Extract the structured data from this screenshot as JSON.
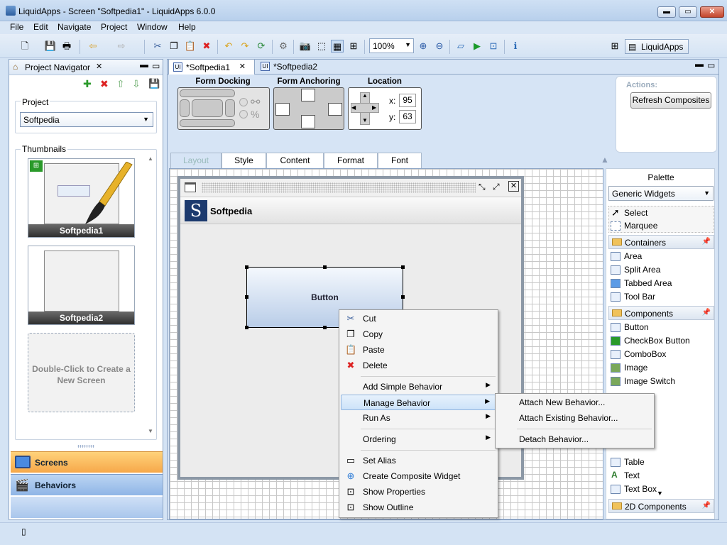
{
  "window": {
    "title": "LiquidApps - Screen \"Softpedia1\" - LiquidApps 6.0.0",
    "min_symbol": "▬",
    "max_symbol": "▭",
    "close_symbol": "✕"
  },
  "menubar": [
    {
      "label": "File"
    },
    {
      "label": "Edit"
    },
    {
      "label": "Navigate"
    },
    {
      "label": "Project"
    },
    {
      "label": "Window"
    },
    {
      "label": "Help"
    }
  ],
  "toolbar": {
    "zoom_value": "100%",
    "perspective_label": "LiquidApps"
  },
  "project_navigator": {
    "title": "Project Navigator",
    "project_label": "Project",
    "project_value": "Softpedia",
    "thumbnails_label": "Thumbnails",
    "thumbnails": [
      {
        "name": "Softpedia1"
      },
      {
        "name": "Softpedia2"
      }
    ],
    "new_screen_hint": "Double-Click to Create a New Screen",
    "screens_label": "Screens",
    "behaviors_label": "Behaviors"
  },
  "editor": {
    "tabs": [
      {
        "label": "*Softpedia1"
      },
      {
        "label": "*Softpedia2"
      }
    ],
    "form_docking_label": "Form Docking",
    "form_anchoring_label": "Form Anchoring",
    "location_label": "Location",
    "location_x_label": "x:",
    "location_x": "95",
    "location_y_label": "y:",
    "location_y": "63",
    "actions_label": "Actions:",
    "refresh_label": "Refresh Composites",
    "layout_tabs": [
      {
        "label": "Layout"
      },
      {
        "label": "Style"
      },
      {
        "label": "Content"
      },
      {
        "label": "Format"
      },
      {
        "label": "Font"
      }
    ]
  },
  "form": {
    "header_text": "Softpedia",
    "logo_letter": "S",
    "button_label": "Button"
  },
  "palette": {
    "title": "Palette",
    "set_value": "Generic Widgets",
    "tools": [
      {
        "label": "Select"
      },
      {
        "label": "Marquee"
      }
    ],
    "containers_label": "Containers",
    "containers": [
      {
        "label": "Area"
      },
      {
        "label": "Split Area"
      },
      {
        "label": "Tabbed Area"
      },
      {
        "label": "Tool Bar"
      }
    ],
    "components_label": "Components",
    "components": [
      {
        "label": "Button"
      },
      {
        "label": "CheckBox Button"
      },
      {
        "label": "ComboBox"
      },
      {
        "label": "Image"
      },
      {
        "label": "Image Switch"
      }
    ],
    "components_lower": [
      {
        "label": "Table"
      },
      {
        "label": "Text"
      },
      {
        "label": "Text Box"
      }
    ],
    "components_2d_label": "2D Components"
  },
  "context_menu": {
    "cut": "Cut",
    "copy": "Copy",
    "paste": "Paste",
    "delete": "Delete",
    "add_simple_behavior": "Add Simple Behavior",
    "manage_behavior": "Manage Behavior",
    "run_as": "Run As",
    "ordering": "Ordering",
    "set_alias": "Set Alias",
    "create_composite": "Create Composite Widget",
    "show_properties": "Show Properties",
    "show_outline": "Show Outline"
  },
  "submenu": {
    "attach_new": "Attach New Behavior...",
    "attach_existing": "Attach Existing Behavior...",
    "detach": "Detach Behavior..."
  }
}
